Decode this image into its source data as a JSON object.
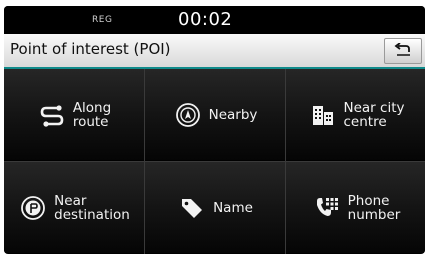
{
  "status_bar": {
    "reg_label": "REG",
    "clock": "00:02"
  },
  "header": {
    "title": "Point of interest (POI)",
    "back_icon": "back-arrow-icon"
  },
  "menu": {
    "items": [
      {
        "label": "Along\nroute",
        "icon": "route-icon"
      },
      {
        "label": "Nearby",
        "icon": "nearby-compass-icon"
      },
      {
        "label": "Near city\ncentre",
        "icon": "city-building-icon"
      },
      {
        "label": "Near\ndestination",
        "icon": "destination-flag-icon"
      },
      {
        "label": "Name",
        "icon": "tag-icon"
      },
      {
        "label": "Phone\nnumber",
        "icon": "phone-keypad-icon"
      }
    ]
  },
  "colors": {
    "accent": "#0f8a8a",
    "screen_background": "#000000",
    "text": "#f2f2f2"
  }
}
